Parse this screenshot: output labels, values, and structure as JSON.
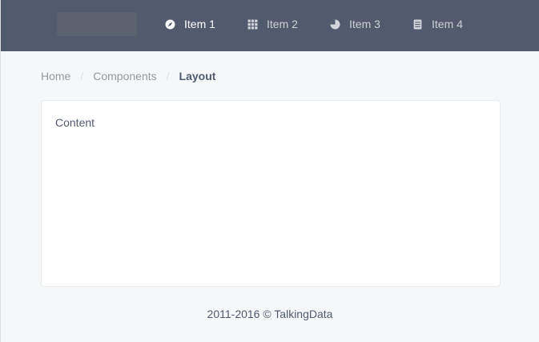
{
  "nav": {
    "items": [
      {
        "label": "Item 1",
        "icon": "compass-icon",
        "active": true
      },
      {
        "label": "Item 2",
        "icon": "grid-icon",
        "active": false
      },
      {
        "label": "Item 3",
        "icon": "pie-chart-icon",
        "active": false
      },
      {
        "label": "Item 4",
        "icon": "document-icon",
        "active": false
      }
    ]
  },
  "breadcrumb": {
    "items": [
      "Home",
      "Components",
      "Layout"
    ],
    "separator": "/"
  },
  "content": {
    "text": "Content"
  },
  "footer": {
    "text": "2011-2016 © TalkingData"
  },
  "colors": {
    "header_bg": "#515a6e",
    "page_bg": "#f5f7f9",
    "text": "#515a6e",
    "muted": "#999999"
  }
}
